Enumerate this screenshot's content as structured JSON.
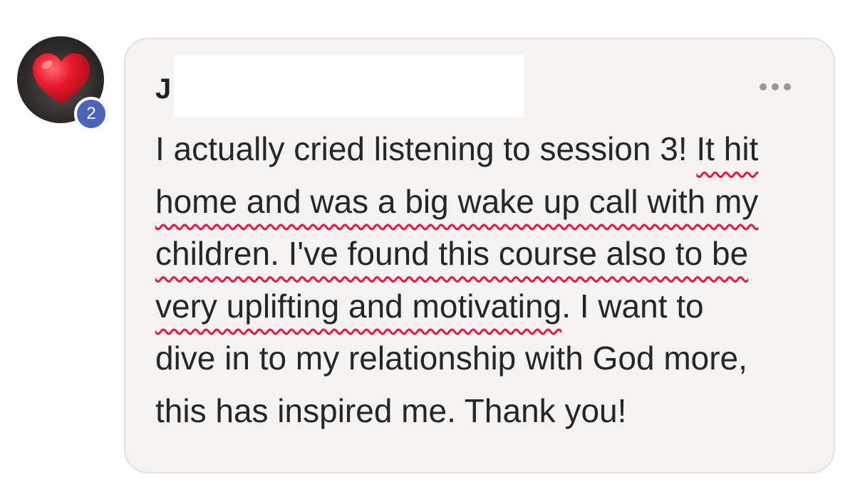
{
  "comment": {
    "author_initial": "J",
    "badge_count": "2",
    "lines": [
      {
        "plain": "I actually cried listening to session 3! ",
        "underlined": "It hit"
      },
      {
        "plain": "",
        "underlined": "home and was a big wake up call with my"
      },
      {
        "plain": "",
        "underlined": "children. I've found this course also to be"
      },
      {
        "plain": ". I want to",
        "underlined": "very uplifting and motivating"
      },
      {
        "plain": "dive in to my relationship with God more,",
        "underlined": ""
      },
      {
        "plain": "this has inspired me. Thank you!",
        "underlined": ""
      }
    ],
    "more_icon": "more-horizontal-icon",
    "avatar_icon": "heart-icon"
  },
  "colors": {
    "card_background": "#f4f3f2",
    "badge": "#4b63b8",
    "underline": "#e8143b",
    "heart": "#e8192c"
  }
}
